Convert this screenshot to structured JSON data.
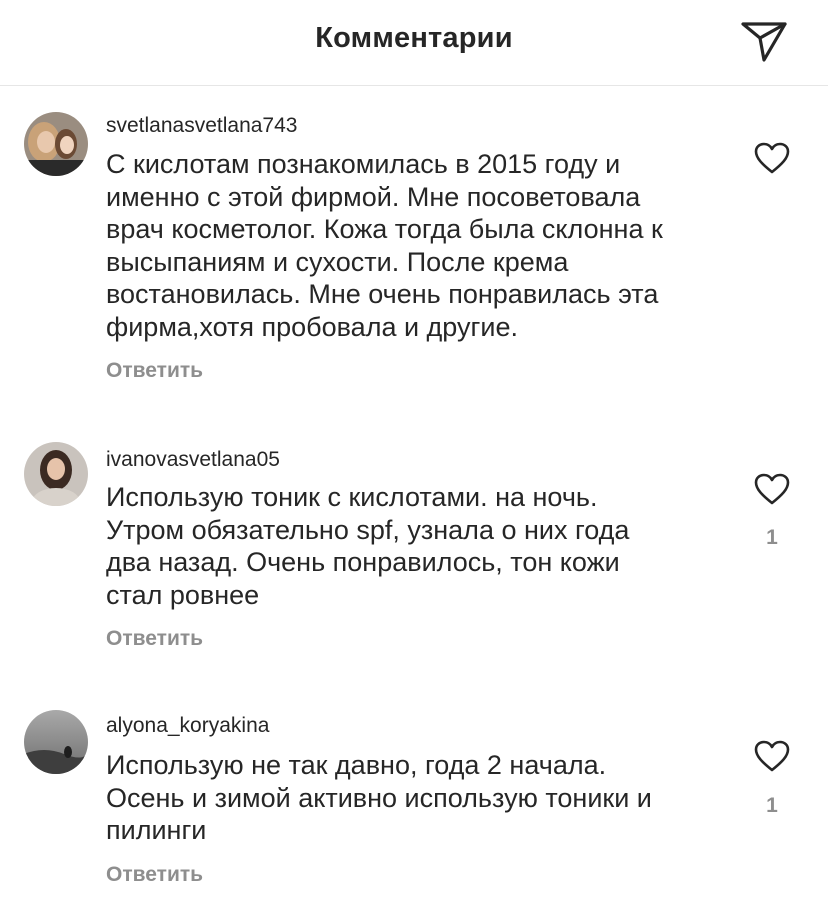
{
  "header": {
    "title": "Комментарии",
    "share_icon": "paper-plane-icon"
  },
  "comments": [
    {
      "username": "svetlanasvetlana743",
      "text_lines": [
        "С кислотам познакомилась в 2015 году и",
        "именно с этой фирмой. Мне посоветовала",
        "врач косметолог. Кожа тогда была склонна к",
        "высыпаниям и сухости. После крема",
        "востановилась. Мне очень понравилась эта",
        "фирма,хотя пробовала и другие."
      ],
      "reply_label": "Ответить",
      "like_icon": "heart-outline-icon",
      "likes": ""
    },
    {
      "username": "ivanovasvetlana05",
      "text_lines": [
        "Использую тоник с кислотами. на ночь.",
        "Утром обязательно spf, узнала о них года",
        "два назад. Очень понравилось, тон кожи",
        "стал ровнее"
      ],
      "reply_label": "Ответить",
      "like_icon": "heart-outline-icon",
      "likes": "1"
    },
    {
      "username": "alyona_koryakina",
      "text_lines": [
        "Использую не так давно, года 2 начала.",
        "Осень и зимой активно использую тоники и",
        "пилинги"
      ],
      "reply_label": "Ответить",
      "like_icon": "heart-outline-icon",
      "likes": "1"
    }
  ],
  "colors": {
    "text": "#262626",
    "secondary": "#8e8e8e",
    "divider": "#e6e6e6"
  }
}
